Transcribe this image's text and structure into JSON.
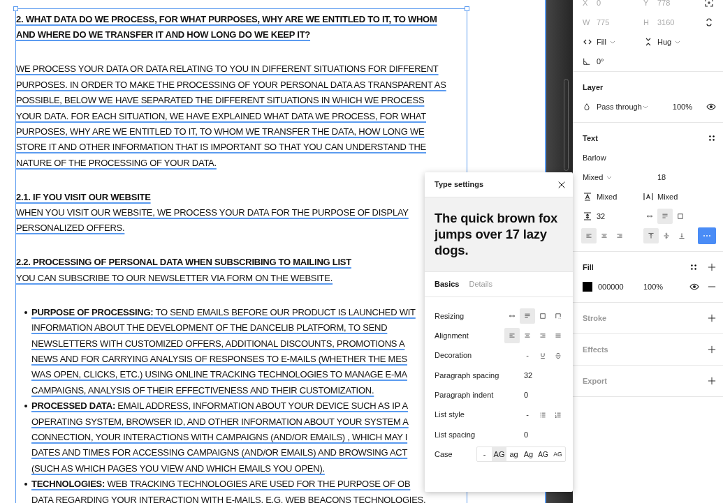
{
  "canvas": {
    "sections": [
      {
        "parts": [
          {
            "kind": "heading",
            "lines": [
              "2. WHAT DATA DO WE PROCESS, FOR WHAT PURPOSES, WHY ARE WE ENTITLED TO IT, TO WHOM",
              "AND WHERE DO WE TRANSFER IT AND HOW LONG DO WE KEEP IT?"
            ]
          }
        ]
      },
      {
        "parts": [
          {
            "kind": "body",
            "lines": [
              "WE PROCESS YOUR DATA OR DATA RELATING TO YOU IN DIFFERENT SITUATIONS FOR DIFFERENT",
              "PURPOSES. IN ORDER TO MAKE THE PROCESSING OF YOUR PERSONAL DATA AS TRANSPARENT AS",
              "POSSIBLE, BELOW WE HAVE SEPARATED THE DIFFERENT SITUATIONS IN WHICH WE PROCESS",
              "YOUR DATA. FOR EACH SITUATION, WE HAVE EXPLAINED WHAT DATA WE PROCESS, FOR WHAT",
              "PURPOSES, WHY ARE WE ENTITLED TO IT, TO WHOM WE TRANSFER THE DATA, HOW LONG WE",
              "STORE IT AND OTHER INFORMATION THAT IS IMPORTANT SO THAT YOU CAN UNDERSTAND THE",
              "NATURE OF THE PROCESSING OF YOUR DATA."
            ]
          }
        ]
      },
      {
        "parts": [
          {
            "kind": "heading",
            "lines": [
              "2.1. IF YOU VISIT OUR WEBSITE"
            ]
          },
          {
            "kind": "body",
            "lines": [
              "WHEN YOU VISIT OUR WEBSITE, WE PROCESS YOUR DATA FOR THE PURPOSE OF DISPLAY",
              "PERSONALIZED OFFERS."
            ]
          }
        ]
      },
      {
        "parts": [
          {
            "kind": "heading",
            "lines": [
              "2.2. PROCESSING OF PERSONAL DATA WHEN SUBSCRIBING TO MAILING LIST"
            ]
          },
          {
            "kind": "body",
            "lines": [
              "YOU CAN SUBSCRIBE TO OUR NEWSLETTER VIA FORM ON THE WEBSITE."
            ]
          }
        ]
      },
      {
        "parts": [
          {
            "kind": "list",
            "items": [
              {
                "lines": [
                  "**PURPOSE OF PROCESSING:** TO SEND EMAILS BEFORE OUR PRODUCT IS LAUNCHED WIT",
                  "INFORMATION ABOUT THE DEVELOPMENT OF THE DANCELIB PLATFORM, TO SEND",
                  "NEWSLETTERS WITH CUSTOMIZED OFFERS, ADDITIONAL DISCOUNTS, PROMOTIONS A",
                  "NEWS AND FOR CARRYING ANALYSIS OF RESPONSES TO E-MAILS (WHETHER THE MES",
                  "WAS OPEN, CLICKS, ETC.) USING ONLINE TRACKING TECHNOLOGIES TO MANAGE E-MA",
                  "CAMPAIGNS, ANALYSIS OF THEIR EFFECTIVENESS AND THEIR CUSTOMIZATION."
                ]
              },
              {
                "lines": [
                  "**PROCESSED DATA:** EMAIL ADDRESS, INFORMATION ABOUT YOUR DEVICE SUCH AS IP A",
                  "OPERATING SYSTEM, BROWSER ID, AND OTHER INFORMATION ABOUT YOUR SYSTEM A",
                  "CONNECTION, YOUR INTERACTIONS WITH CAMPAIGNS (AND/OR EMAILS) , WHICH MAY I",
                  "DATES AND TIMES FOR ACCESSING CAMPAIGNS (AND/OR EMAILS) AND BROWSING ACT",
                  "(SUCH AS WHICH PAGES YOU VIEW AND WHICH EMAILS YOU OPEN)."
                ]
              },
              {
                "lines": [
                  "**TECHNOLOGIES:** WEB TRACKING TECHNOLOGIES ARE USED FOR THE PURPOSE OF OB",
                  "DATA REGARDING YOUR INTERACTION WITH E-MAILS, E.G. WEB BEACONS TECHNOLOGIES."
                ]
              }
            ]
          }
        ]
      }
    ]
  },
  "properties": {
    "position": [
      {
        "label": "X",
        "value": "0"
      },
      {
        "label": "Y",
        "value": "778"
      }
    ],
    "size": [
      {
        "label": "W",
        "value": "775"
      },
      {
        "label": "H",
        "value": "3160"
      }
    ],
    "sizing": [
      "Fill",
      "Hug"
    ],
    "rotation": "0°",
    "layer": {
      "title": "Layer",
      "blend": "Pass through",
      "opacity": "100%"
    },
    "text": {
      "title": "Text",
      "font": "Barlow",
      "weight": "Mixed",
      "font_size": "18",
      "line_height": "Mixed",
      "letter_spacing": "Mixed",
      "paragraph_spacing": "32",
      "resize": [
        {
          "selected": false
        },
        {
          "selected": true
        },
        {
          "selected": false
        }
      ],
      "align": [
        {
          "selected": true
        },
        {
          "selected": false
        },
        {
          "selected": false
        }
      ],
      "valign": [
        {
          "selected": true
        },
        {
          "selected": false
        },
        {
          "selected": false
        }
      ],
      "more_selected": true
    },
    "fill": {
      "title": "Fill",
      "color": "#000000",
      "hex": "000000",
      "opacity": "100%"
    },
    "sections": [
      "Stroke",
      "Effects",
      "Export"
    ]
  },
  "type_settings": {
    "title": "Type settings",
    "preview": "The quick brown fox jumps over 17 lazy dogs.",
    "tabs": [
      {
        "label": "Basics",
        "selected": true
      },
      {
        "label": "Details",
        "selected": false
      }
    ],
    "rows": [
      {
        "label": "Resizing",
        "kind": "resizing",
        "options": [
          {
            "selected": false
          },
          {
            "selected": true
          },
          {
            "selected": false
          },
          {
            "selected": false
          }
        ]
      },
      {
        "label": "Alignment",
        "kind": "alignment",
        "options": [
          {
            "selected": true
          },
          {
            "selected": false
          },
          {
            "selected": false
          },
          {
            "selected": false
          }
        ]
      },
      {
        "label": "Decoration",
        "kind": "decoration",
        "options": [
          {
            "text": "-",
            "selected": false
          },
          {
            "selected": false
          },
          {
            "selected": false
          }
        ]
      },
      {
        "label": "Paragraph spacing",
        "kind": "value",
        "value": "32"
      },
      {
        "label": "Paragraph indent",
        "kind": "value",
        "value": "0"
      },
      {
        "label": "List style",
        "kind": "liststyle",
        "options": [
          {
            "text": "-",
            "selected": false
          },
          {
            "selected": false
          },
          {
            "selected": false
          }
        ]
      },
      {
        "label": "List spacing",
        "kind": "value",
        "value": "0"
      },
      {
        "label": "Case",
        "kind": "segmented",
        "options": [
          {
            "text": "-",
            "selected": false
          },
          {
            "text": "AG",
            "selected": true
          },
          {
            "text": "ag",
            "selected": false
          },
          {
            "text": "Ag",
            "selected": false
          },
          {
            "text": "AG",
            "selected": false
          },
          {
            "text": "AG",
            "selected": false
          }
        ]
      }
    ]
  }
}
